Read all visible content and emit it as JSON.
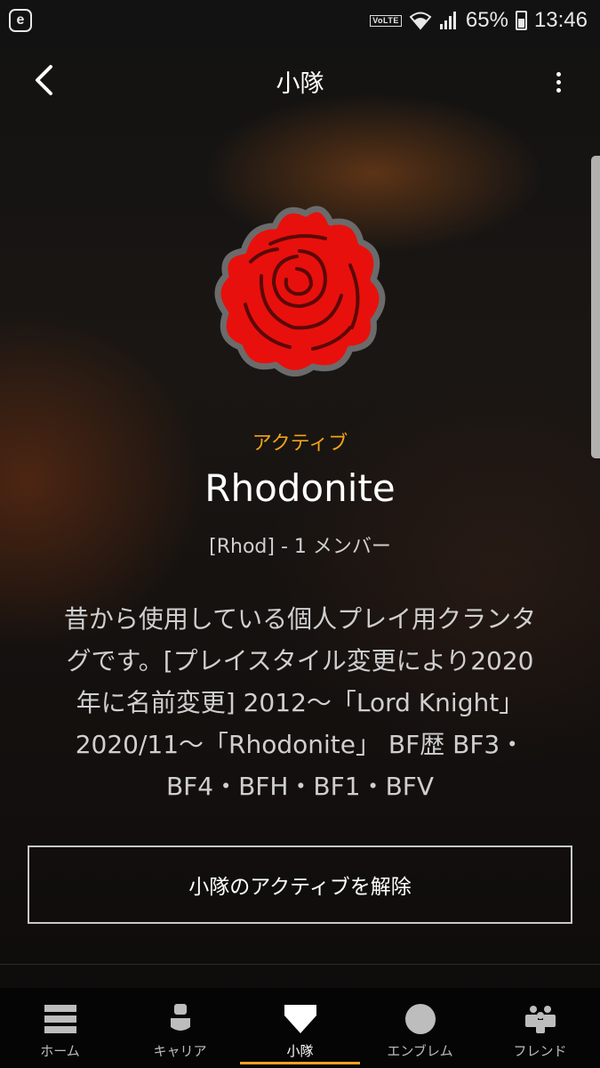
{
  "status_bar": {
    "app_icon_letter": "e",
    "network_label": "VoLTE",
    "battery": "65%",
    "time": "13:46"
  },
  "header": {
    "title": "小隊",
    "back_icon": "chevron-left-icon",
    "menu_icon": "more-vert-icon"
  },
  "squad": {
    "emblem": "red-rose-emblem",
    "status": "アクティブ",
    "name": "Rhodonite",
    "meta": "[Rhod] - 1 メンバー",
    "description_lines": [
      "昔から使用している個人プレイ用クランタ",
      "グです。[プレイスタイル変更により2020",
      "年に名前変更] 2012〜「Lord Knight」",
      "2020/11〜「Rhodonite」 BF歴 BF3・",
      "BF4・BFH・BF1・BFV"
    ],
    "action_button": "小隊のアクティブを解除"
  },
  "colors": {
    "accent": "#f3a21a",
    "emblem_red": "#e8100c",
    "text_secondary": "#cfcfcf"
  },
  "bottom_nav": {
    "items": [
      {
        "label": "ホーム",
        "icon": "home-menu-icon",
        "active": false
      },
      {
        "label": "キャリア",
        "icon": "career-bust-icon",
        "active": false
      },
      {
        "label": "小隊",
        "icon": "squad-shield-icon",
        "active": true
      },
      {
        "label": "エンブレム",
        "icon": "emblem-circle-icon",
        "active": false
      },
      {
        "label": "フレンド",
        "icon": "friends-icon",
        "active": false
      }
    ]
  }
}
